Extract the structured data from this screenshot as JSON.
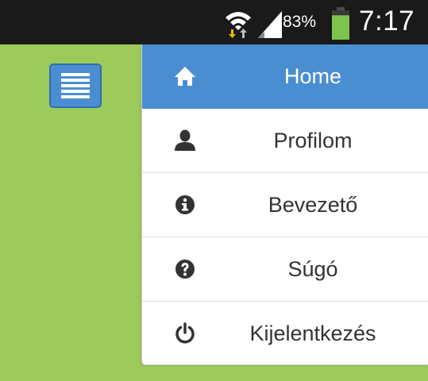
{
  "status_bar": {
    "battery_percent": "83%",
    "clock": "7:17",
    "icons": [
      "wifi-icon",
      "signal-icon",
      "battery-icon"
    ],
    "battery_level": 0.83,
    "colors": {
      "background": "#1a1a1a",
      "battery": "#7ec34b",
      "data_arrows": "#f0b400"
    }
  },
  "app": {
    "background_color": "#9ccb5c",
    "menu_toggle": {
      "icon": "hamburger-menu-icon",
      "color": "#4a8ed1"
    }
  },
  "drawer": {
    "accent_color": "#4a8ed1",
    "items": [
      {
        "label": "Home",
        "icon": "home-icon",
        "active": true
      },
      {
        "label": "Profilom",
        "icon": "user-icon",
        "active": false
      },
      {
        "label": "Bevezető",
        "icon": "info-icon",
        "active": false
      },
      {
        "label": "Súgó",
        "icon": "help-icon",
        "active": false
      },
      {
        "label": "Kijelentkezés",
        "icon": "power-icon",
        "active": false
      }
    ]
  }
}
